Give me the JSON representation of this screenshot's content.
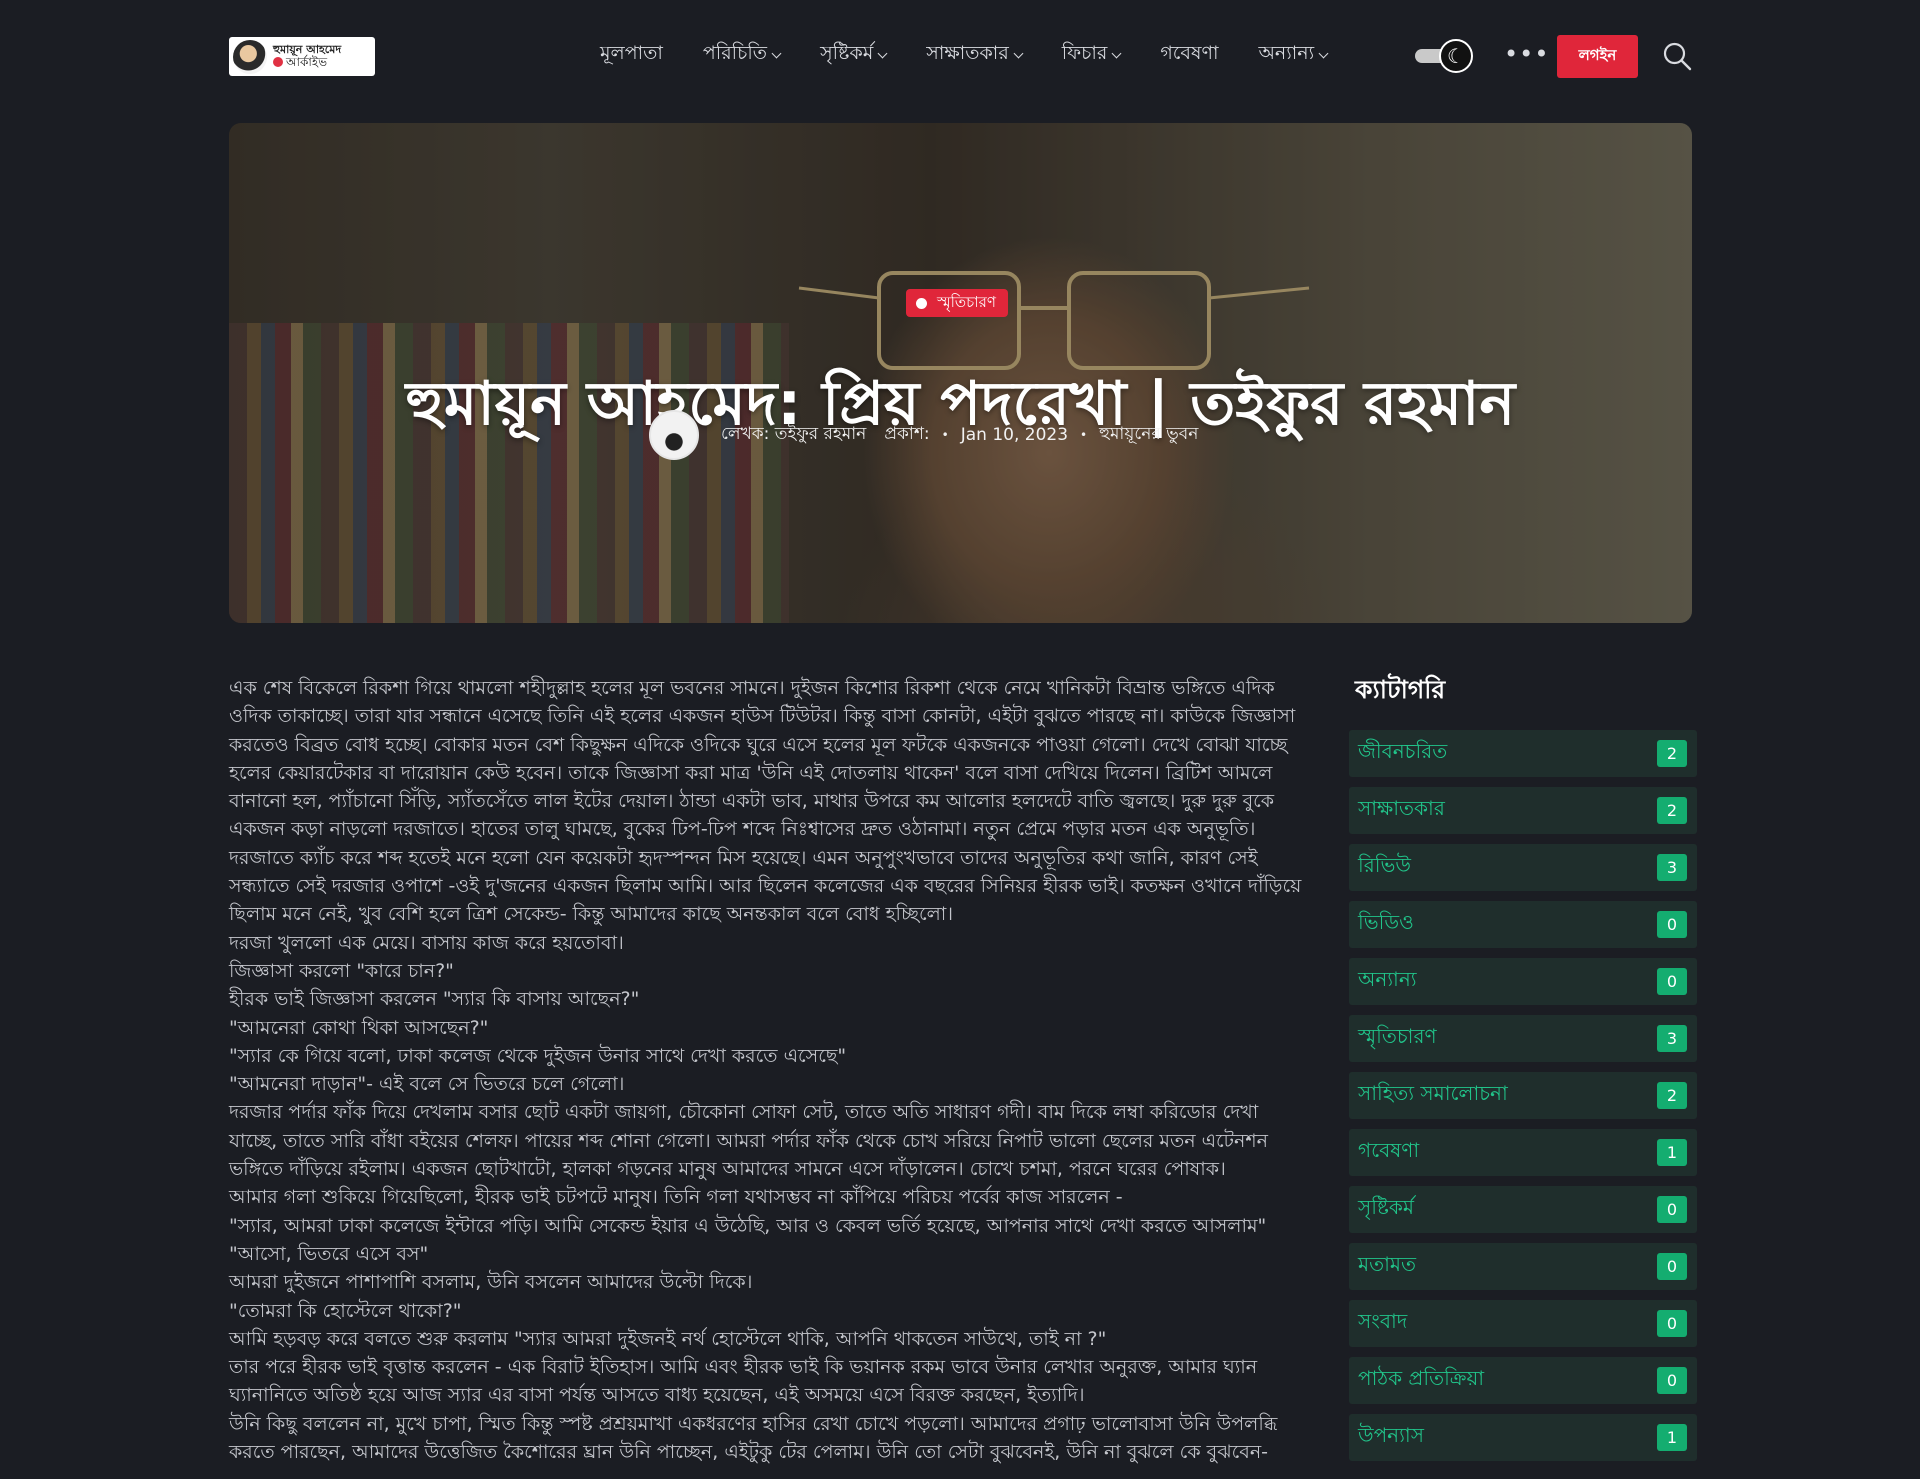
{
  "header": {
    "logo": {
      "line1": "হুমায়ূন আহমেদ",
      "line2": "আর্কাইভ"
    },
    "nav": [
      {
        "label": "মূলপাতা",
        "has_dropdown": false
      },
      {
        "label": "পরিচিতি",
        "has_dropdown": true
      },
      {
        "label": "সৃষ্টিকর্ম",
        "has_dropdown": true
      },
      {
        "label": "সাক্ষাতকার",
        "has_dropdown": true
      },
      {
        "label": "ফিচার",
        "has_dropdown": true
      },
      {
        "label": "গবেষণা",
        "has_dropdown": false
      },
      {
        "label": "অন্যান্য",
        "has_dropdown": true
      }
    ],
    "login_label": "লগইন",
    "more_label": "•••",
    "theme_icon": "☾"
  },
  "hero": {
    "category": "স্মৃতিচারণ",
    "title": "হুমায়ূন আহমেদ: প্রিয় পদরেখা | তইফুর রহমান",
    "author_text": "লেখক: তইফুর রহমান",
    "published_label": "প্রকাশ:",
    "date": "Jan 10, 2023",
    "section": "হুমায়ূনের ভুবন",
    "separator": "•"
  },
  "article": {
    "paragraphs": [
      "এক শেষ বিকেলে রিকশা গিয়ে থামলো শহীদুল্লাহ হলের মূল ভবনের সামনে। দুইজন কিশোর রিকশা থেকে নেমে খানিকটা বিভ্রান্ত ভঙ্গিতে এদিক ওদিক তাকাচ্ছে। তারা যার সন্ধানে এসেছে তিনি এই হলের একজন হাউস টিউটর। কিন্তু বাসা কোনটা, এইটা বুঝতে পারছে না। কাউকে জিজ্ঞাসা করতেও বিব্রত বোধ হচ্ছে। বোকার মতন বেশ কিছুক্ষন এদিকে ওদিকে ঘুরে এসে হলের মূল ফটকে একজনকে পাওয়া গেলো। দেখে বোঝা যাচ্ছে হলের কেয়ারটেকার বা দারোয়ান কেউ হবেন। তাকে জিজ্ঞাসা করা মাত্র 'উনি এই দোতলায় থাকেন' বলে বাসা দেখিয়ে দিলেন। ব্রিটিশ আমলে বানানো হল, প্যাঁচানো সিঁড়ি, স্যাঁতসেঁতে লাল ইটের দেয়াল। ঠান্ডা একটা ভাব, মাথার উপরে কম আলোর হলদেটে বাতি জ্বলছে। দুরু দুরু বুকে একজন কড়া নাড়লো দরজাতে। হাতের তালু ঘামছে, বুকের ঢিপ-ঢিপ শব্দে নিঃশ্বাসের দ্রুত ওঠানামা। নতুন প্রেমে পড়ার মতন এক অনুভূতি। দরজাতে ক্যাঁচ করে শব্দ হতেই মনে হলো যেন কয়েকটা হৃদস্পন্দন মিস হয়েছে। এমন অনুপুংখভাবে তাদের অনুভূতির কথা জানি, কারণ সেই সন্ধ্যাতে সেই দরজার ওপাশে -ওই দু'জনের একজন ছিলাম আমি। আর ছিলেন কলেজের এক বছরের সিনিয়র হীরক ভাই। কতক্ষন ওখানে দাঁড়িয়ে ছিলাম মনে নেই, খুব বেশি হলে ত্রিশ সেকেন্ড- কিন্তু আমাদের কাছে অনন্তকাল বলে বোধ হচ্ছিলো।",
      "দরজা খুললো এক মেয়ে। বাসায় কাজ করে হয়তোবা।",
      "জিজ্ঞাসা করলো \"কারে চান?\"",
      "হীরক ভাই জিজ্ঞাসা করলেন \"স্যার কি বাসায় আছেন?\"",
      "\"আমনেরা কোথা থিকা আসছেন?\"",
      "\"স্যার কে গিয়ে বলো, ঢাকা কলেজ থেকে দুইজন উনার সাথে দেখা করতে এসেছে\"",
      "\"আমনেরা দাড়ান\"- এই বলে সে ভিতরে চলে গেলো।",
      "দরজার পর্দার ফাঁক দিয়ে দেখলাম বসার ছোট একটা জায়গা, চৌকোনা সোফা সেট, তাতে অতি সাধারণ গদী। বাম দিকে লম্বা করিডোর দেখা যাচ্ছে, তাতে সারি বাঁধা বইয়ের শেলফ। পায়ের শব্দ শোনা গেলো। আমরা পর্দার ফাঁক থেকে চোখ সরিয়ে নিপাট ভালো ছেলের মতন এটেনশন ভঙ্গিতে দাঁড়িয়ে রইলাম। একজন ছোটখাটো, হালকা গড়নের মানুষ আমাদের সামনে এসে দাঁড়ালেন। চোখে চশমা, পরনে ঘরের পোষাক।",
      "আমার গলা শুকিয়ে গিয়েছিলো, হীরক ভাই চটপটে মানুষ। তিনি গলা যথাসম্ভব না কাঁপিয়ে পরিচয় পর্বের কাজ সারলেন -",
      "\"স্যার, আমরা ঢাকা কলেজে ইন্টারে পড়ি। আমি সেকেন্ড ইয়ার এ উঠেছি, আর ও কেবল ভর্তি হয়েছে, আপনার সাথে দেখা করতে আসলাম\"",
      "\"আসো, ভিতরে এসে বস\"",
      "আমরা দুইজনে পাশাপাশি বসলাম, উনি বসলেন আমাদের উল্টো দিকে।",
      "\"তোমরা কি হোস্টেলে থাকো?\"",
      "আমি হড়বড় করে বলতে শুরু করলাম \"স্যার আমরা দুইজনই নর্থ হোস্টেলে থাকি, আপনি থাকতেন সাউথে, তাই না ?\"",
      "তার পরে হীরক ভাই বৃত্তান্ত করলেন - এক বিরাট ইতিহাস। আমি এবং হীরক ভাই কি ভয়ানক রকম ভাবে উনার লেখার অনুরক্ত, আমার ঘ্যান ঘ্যানানিতে অতিষ্ঠ হয়ে আজ স্যার এর বাসা পর্যন্ত আসতে বাধ্য হয়েছেন, এই অসময়ে এসে বিরক্ত করছেন, ইত্যাদি।",
      "উনি কিছু বললেন না, মুখে চাপা, স্মিত কিন্তু স্পষ্ট প্রশ্রয়মাখা একধরণের হাসির রেখা চোখে পড়লো। আমাদের প্রগাঢ় ভালোবাসা উনি উপলব্ধি করতে পারছেন, আমাদের উত্তেজিত কৈশোরের ঘ্রান উনি পাচ্ছেন, এইটুকু টের পেলাম। উনি তো সেটা বুঝবেনই, উনি না বুঝলে কে বুঝবেন-"
    ]
  },
  "sidebar": {
    "title": "ক্যাটাগরি",
    "categories": [
      {
        "label": "জীবনচরিত",
        "count": "2"
      },
      {
        "label": "সাক্ষাতকার",
        "count": "2"
      },
      {
        "label": "রিভিউ",
        "count": "3"
      },
      {
        "label": "ভিডিও",
        "count": "0"
      },
      {
        "label": "অন্যান্য",
        "count": "0"
      },
      {
        "label": "স্মৃতিচারণ",
        "count": "3"
      },
      {
        "label": "সাহিত্য সমালোচনা",
        "count": "2"
      },
      {
        "label": "গবেষণা",
        "count": "1"
      },
      {
        "label": "সৃষ্টিকর্ম",
        "count": "0"
      },
      {
        "label": "মতামত",
        "count": "0"
      },
      {
        "label": "সংবাদ",
        "count": "0"
      },
      {
        "label": "পাঠক প্রতিক্রিয়া",
        "count": "0"
      },
      {
        "label": "উপন্যাস",
        "count": "1"
      }
    ]
  },
  "colors": {
    "background": "#1b1d23",
    "accent_red": "#e0263a",
    "category_text": "#21c48a",
    "category_count_bg": "#14ad70"
  },
  "icons": {
    "search": "search-icon",
    "theme": "moon-icon",
    "more": "more-dots-icon"
  }
}
